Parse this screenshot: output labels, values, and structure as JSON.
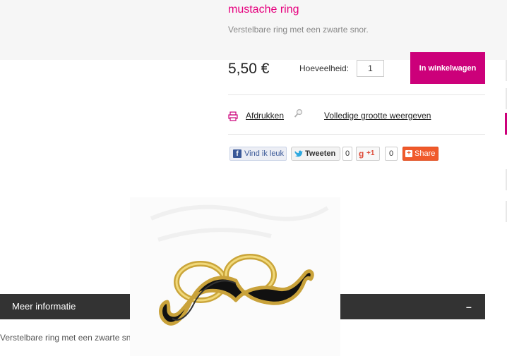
{
  "product": {
    "title": "mustache ring",
    "short_description": "Verstelbare ring met een zwarte snor.",
    "price": "5,50 €",
    "quantity_label": "Hoeveelheid:",
    "quantity_value": "1",
    "add_to_cart_label": "In winkelwagen"
  },
  "actions": {
    "print_label": "Afdrukken",
    "full_size_label": "Volledige grootte weergeven"
  },
  "social": {
    "facebook_label": "Vind ik leuk",
    "tweet_label": "Tweeten",
    "tweet_count": "0",
    "gplus_label": "+1",
    "gplus_count": "0",
    "share_label": "Share"
  },
  "more_info": {
    "title": "Meer informatie",
    "toggle": "–",
    "text": "Verstelbare ring met een zwarte snor."
  },
  "colors": {
    "accent": "#e6007e",
    "cart_button": "#cc007a",
    "bar": "#333333"
  }
}
